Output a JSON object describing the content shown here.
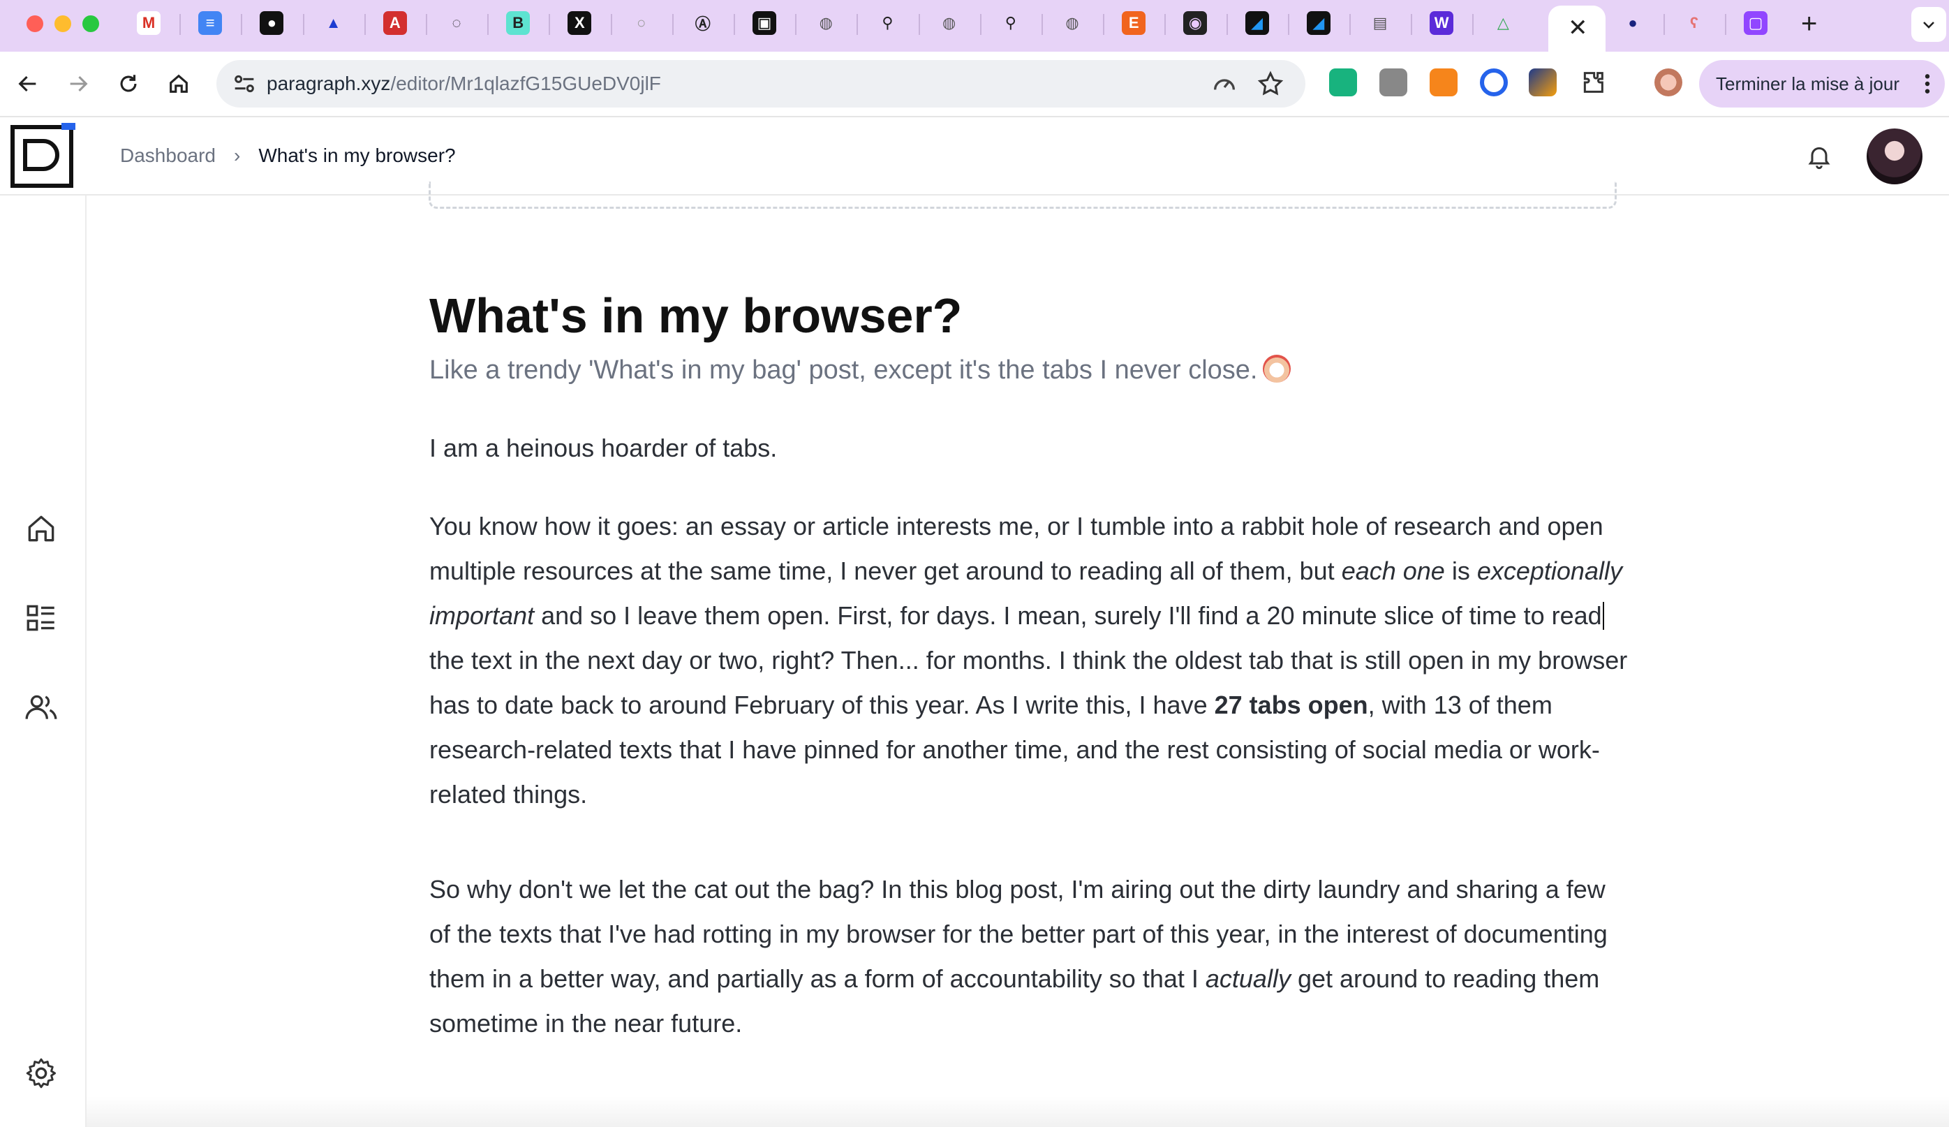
{
  "browser": {
    "tabs": [
      {
        "icon": "gmail-icon",
        "glyph": "M",
        "color": "#ffffff",
        "fg": "#d93025"
      },
      {
        "icon": "google-docs-icon",
        "glyph": "≡",
        "color": "#4285f4",
        "fg": "#ffffff"
      },
      {
        "icon": "substack-icon",
        "glyph": "●",
        "color": "#111111",
        "fg": "#ffffff"
      },
      {
        "icon": "triangle-app-icon",
        "glyph": "▲",
        "color": "#e7d3f7",
        "fg": "#1d3bd1"
      },
      {
        "icon": "pdf-icon",
        "glyph": "A",
        "color": "#d32f2f",
        "fg": "#ffffff"
      },
      {
        "icon": "loading-spinner-icon",
        "glyph": "◌",
        "color": "#e7d3f7",
        "fg": "#222222"
      },
      {
        "icon": "beehiiv-icon",
        "glyph": "B",
        "color": "#5ee3d1",
        "fg": "#222222"
      },
      {
        "icon": "x-twitter-icon",
        "glyph": "X",
        "color": "#111111",
        "fg": "#ffffff"
      },
      {
        "icon": "blank-page-icon",
        "glyph": "○",
        "color": "#e7d3f7",
        "fg": "#999999"
      },
      {
        "icon": "a-circle-icon",
        "glyph": "Ⓐ",
        "color": "#e7d3f7",
        "fg": "#222222"
      },
      {
        "icon": "game-controller-icon",
        "glyph": "▣",
        "color": "#111111",
        "fg": "#ffffff"
      },
      {
        "icon": "globe-icon",
        "glyph": "◍",
        "color": "#e7d3f7",
        "fg": "#555555"
      },
      {
        "icon": "link-tool-icon",
        "glyph": "⚲",
        "color": "#e7d3f7",
        "fg": "#222222"
      },
      {
        "icon": "globe-icon",
        "glyph": "◍",
        "color": "#e7d3f7",
        "fg": "#555555"
      },
      {
        "icon": "link-tool-icon",
        "glyph": "⚲",
        "color": "#e7d3f7",
        "fg": "#222222"
      },
      {
        "icon": "globe-icon",
        "glyph": "◍",
        "color": "#e7d3f7",
        "fg": "#555555"
      },
      {
        "icon": "etsy-icon",
        "glyph": "E",
        "color": "#f1641e",
        "fg": "#ffffff"
      },
      {
        "icon": "orb-app-icon",
        "glyph": "◉",
        "color": "#222222",
        "fg": "#e9c8ff"
      },
      {
        "icon": "zora-blue-icon",
        "glyph": "◢",
        "color": "#111111",
        "fg": "#2196f3"
      },
      {
        "icon": "zora-blue-icon",
        "glyph": "◢",
        "color": "#111111",
        "fg": "#2196f3"
      },
      {
        "icon": "books-icon",
        "glyph": "▤",
        "color": "#e7d3f7",
        "fg": "#555555"
      },
      {
        "icon": "w-app-icon",
        "glyph": "W",
        "color": "#5b2bd9",
        "fg": "#ffffff"
      },
      {
        "icon": "google-drive-icon",
        "glyph": "△",
        "color": "#e7d3f7",
        "fg": "#34a853"
      }
    ],
    "after_tabs": [
      {
        "icon": "dark-globe-icon",
        "glyph": "●",
        "color": "#e7d3f7",
        "fg": "#1a237e"
      },
      {
        "icon": "ear-app-icon",
        "glyph": "ʕ",
        "color": "#e7d3f7",
        "fg": "#e57373"
      },
      {
        "icon": "twitch-icon",
        "glyph": "▢",
        "color": "#9146ff",
        "fg": "#ffffff"
      }
    ],
    "active_tab_close": "✕",
    "new_tab_label": "+",
    "url_host": "paragraph.xyz",
    "url_path": "/editor/Mr1qlazfG15GUeDV0jlF",
    "update_button": "Terminer la mise à jour"
  },
  "header": {
    "breadcrumb_root": "Dashboard",
    "breadcrumb_sep": "›",
    "breadcrumb_current": "What's in my browser?"
  },
  "post": {
    "title": "What's in my browser?",
    "subtitle": "Like a trendy 'What's in my bag' post, except it's the tabs I never close.",
    "p1": "I am a heinous hoarder of tabs.",
    "p2_a": "You know how it goes: an essay or article interests me, or I tumble into a rabbit hole of research and open multiple resources at the same time, I never get around to reading all of them, but ",
    "p2_em1": "each one",
    "p2_b": " is ",
    "p2_em2": "exceptionally important",
    "p2_c": " and so I leave them open. First, for days. I mean, surely I'll find a 20 minute slice of time to read",
    "p2_d": " the text in the next day or two, right? Then... for months. I think the oldest tab that is still open in my browser has to date back to around February of this year. As I write this, I have ",
    "p2_strong": "27 tabs open",
    "p2_e": ", with 13 of them research-related texts that I have pinned for another time, and the rest consisting of social media or work-related things.",
    "p3_a": "So why don't we let the cat out the bag? In this blog post, I'm airing out the dirty laundry and sharing a few of the texts that I've had rotting in my browser for the better part of this year, in the interest of documenting them in a better way, and partially as a form of accountability so that I ",
    "p3_em": "actually",
    "p3_b": " get around to reading them sometime in the near future."
  }
}
